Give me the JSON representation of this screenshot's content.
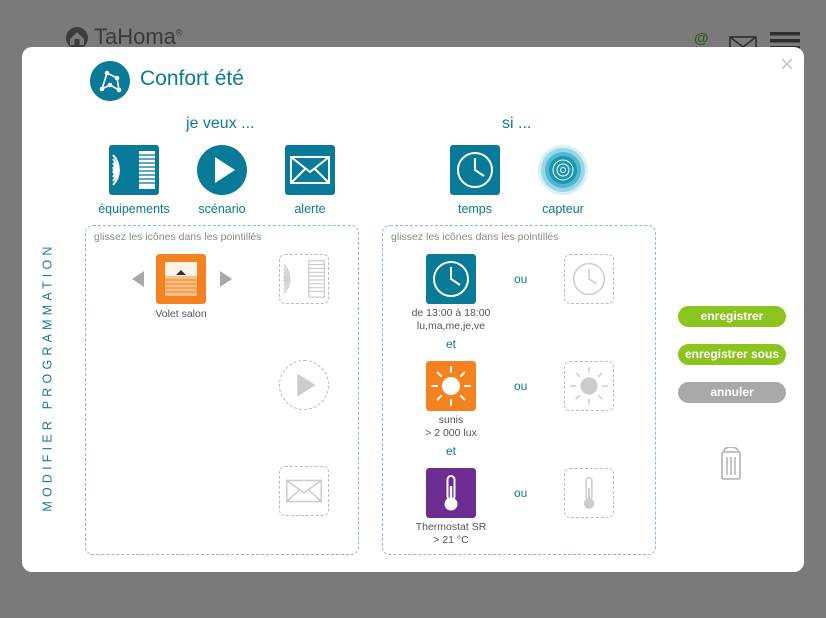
{
  "app": {
    "logo_text": "TaHoma",
    "logo_mark": "®"
  },
  "topbar": {
    "at_symbol": "@"
  },
  "modal": {
    "title": "Confort été",
    "close_glyph": "×",
    "side_label": "MODIFIER PROGRAMMATION"
  },
  "actions": {
    "header": "je veux ...",
    "palette": [
      {
        "label": "équipements",
        "icon": "shutter-equipment-icon"
      },
      {
        "label": "scénario",
        "icon": "play-scenario-icon"
      },
      {
        "label": "alerte",
        "icon": "envelope-alert-icon"
      }
    ],
    "drop_hint": "glissez les icônes dans les pointillés",
    "device": {
      "name": "Volet salon",
      "icon": "shutter-open-icon"
    }
  },
  "conditions": {
    "header": "si ...",
    "palette": [
      {
        "label": "temps",
        "icon": "clock-icon"
      },
      {
        "label": "capteur",
        "icon": "sensor-wave-icon"
      }
    ],
    "drop_hint": "glissez les icônes dans les pointillés",
    "rules": [
      {
        "line1": "de 13:00 à 18:00",
        "line2": "lu,ma,me,je,ve",
        "icon": "clock-icon",
        "color": "#0a7a99"
      },
      {
        "line1": "sunis",
        "line2": "> 2 000 lux",
        "icon": "sun-icon",
        "color": "#f58220"
      },
      {
        "line1": "Thermostat SR",
        "line2": "> 21 °C",
        "icon": "thermometer-icon",
        "color": "#6d2c91"
      }
    ],
    "or_label": "ou",
    "and_label": "et"
  },
  "buttons": {
    "save": "enregistrer",
    "save_as": "enregistrer sous",
    "cancel": "annuler"
  }
}
